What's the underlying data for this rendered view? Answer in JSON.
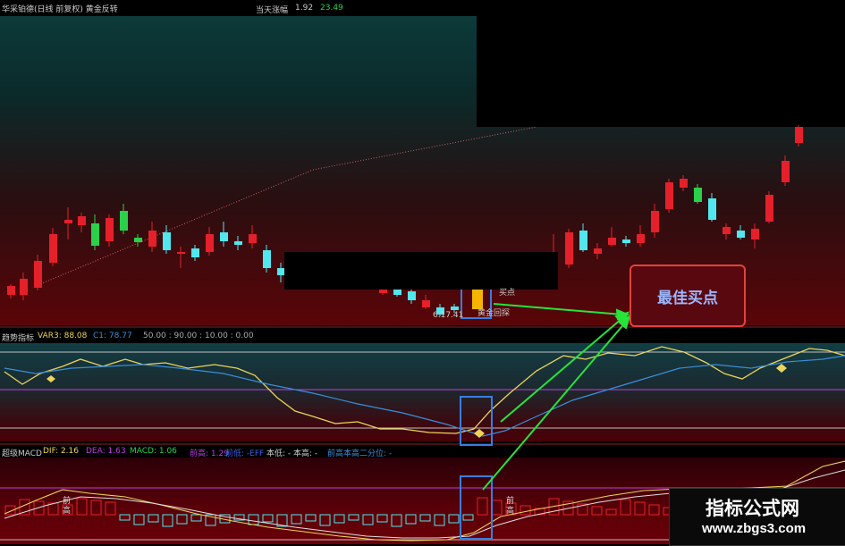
{
  "main_header": {
    "title": "华采铂德(日线 前复权) 黄金反转",
    "change_label": "当天涨幅",
    "change_value": "1.92",
    "change_value2": "23.49"
  },
  "candle_labels": {
    "low_price": "6.17.41",
    "gold_label": "黄金回探",
    "buy_hint": "买点"
  },
  "ind_header": {
    "name": "趋势指标",
    "var3": "VAR3: 88.08",
    "c1": "C1: 78.77",
    "levels": "50.00 : 90.00 : 10.00 : 0.00"
  },
  "macd_header": {
    "name": "超级MACD",
    "dif": "DIF: 2.16",
    "dea": "DEA: 1.63",
    "macd": "MACD: 1.06",
    "qian_gao": "前高: 1.29",
    "misc": "前低: -EFF",
    "ben_di": "本低: -  本高: -",
    "two_q": "前高本高二分位: -"
  },
  "macd_labels": {
    "left": "前高",
    "right": "前高"
  },
  "buy_box": {
    "label": "最佳买点"
  },
  "watermark": {
    "title": "指标公式网",
    "url": "www.zbgs3.com"
  },
  "colors": {
    "up": "#e5202a",
    "down": "#52e6ee",
    "green": "#2bd14a",
    "yellow": "#ecd35a",
    "blue": "#3a8dd8",
    "magenta": "#c23ce0",
    "arrow": "#26e43a"
  }
}
